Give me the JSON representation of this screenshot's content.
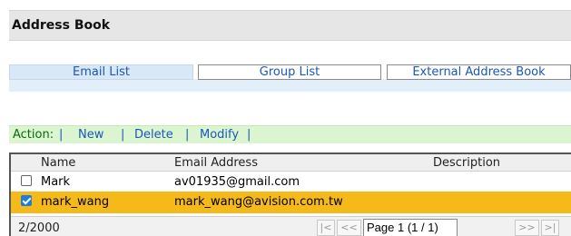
{
  "header": {
    "title": "Address Book"
  },
  "tabs": [
    {
      "label": "Email List",
      "active": true
    },
    {
      "label": "Group List",
      "active": false
    },
    {
      "label": "External Address Book",
      "active": false
    }
  ],
  "actions": {
    "label": "Action:",
    "sep": "|",
    "new_label": "New",
    "delete_label": "Delete",
    "modify_label": "Modify"
  },
  "table": {
    "columns": [
      "Name",
      "Email Address",
      "Description"
    ],
    "rows": [
      {
        "name": "Mark",
        "email": "av01935@gmail.com",
        "description": "",
        "checked": false
      },
      {
        "name": "mark_wang",
        "email": "mark_wang@avision.com.tw",
        "description": "",
        "checked": true
      }
    ]
  },
  "footer": {
    "count": "2/2000",
    "first": "|<",
    "prev": "<<",
    "page": "Page 1 (1 / 1)",
    "next": ">>",
    "last": ">|"
  },
  "colors": {
    "accent": "#1b56b9",
    "selected_row": "#f5b919",
    "action_bar": "#dbf5d0",
    "tab_active": "#d9e8f6"
  }
}
